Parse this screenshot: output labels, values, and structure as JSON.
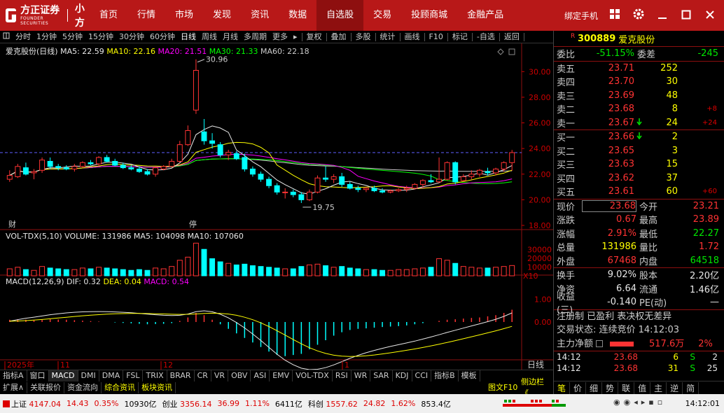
{
  "app": {
    "logo": "方正证券",
    "logo_sub": "FOUNDER SECURITIES",
    "brand": "小方",
    "menu": [
      {
        "label": "首页"
      },
      {
        "label": "行情"
      },
      {
        "label": "市场"
      },
      {
        "label": "发现"
      },
      {
        "label": "资讯"
      },
      {
        "label": "数据"
      },
      {
        "label": "自选股"
      },
      {
        "label": "交易"
      },
      {
        "label": "投顾商城"
      },
      {
        "label": "金融产品"
      }
    ],
    "menu_active_index": 6,
    "bind_phone": "绑定手机"
  },
  "toolbar": {
    "items": [
      "分时",
      "1分钟",
      "5分钟",
      "15分钟",
      "30分钟",
      "60分钟",
      "日线",
      "周线",
      "月线",
      "多周期",
      "更多"
    ],
    "active": "日线",
    "right_items": [
      "复权",
      "叠加",
      "多股",
      "统计",
      "画线",
      "F10",
      "标记",
      "-自选",
      "返回"
    ]
  },
  "chart": {
    "title": "爱克股份(日线)",
    "ma_legend": {
      "ma5": "MA5: 22.59",
      "ma10": "MA10: 22.16",
      "ma20": "MA20: 21.51",
      "ma30": "MA30: 21.33",
      "ma60": "MA60: 22.18"
    },
    "high_label": "30.96",
    "low_label": "19.75",
    "marker_cai": "财",
    "marker_ting": "停",
    "price_axis": [
      "30.00",
      "28.00",
      "26.00",
      "24.00",
      "22.00",
      "20.00",
      "18.00"
    ],
    "vol_legend": "VOL-TDX(5,10)  VOLUME: 131986  MA5: 104098  MA10: 107060",
    "vol_axis": [
      "30000",
      "20000",
      "10000"
    ],
    "vol_unit": "X10",
    "macd_legend_prefix": "MACD(12,26,9)",
    "macd_dif": "DIF: 0.32",
    "macd_dea": "DEA: 0.04",
    "macd_val": "MACD: 0.54",
    "macd_axis": [
      "1.00",
      "0.00"
    ],
    "date_axis": [
      "2025年",
      "11",
      "12",
      "1"
    ],
    "period_label": "日线"
  },
  "chart_data": {
    "type": "candlestick",
    "title": "爱克股份(日线)",
    "ylim": [
      18.0,
      31.0
    ],
    "candles": [
      {
        "o": 21.6,
        "h": 22.3,
        "l": 21.4,
        "c": 21.9
      },
      {
        "o": 21.8,
        "h": 22.8,
        "l": 21.7,
        "c": 22.6
      },
      {
        "o": 22.5,
        "h": 22.9,
        "l": 21.9,
        "c": 22.0
      },
      {
        "o": 22.1,
        "h": 22.4,
        "l": 21.6,
        "c": 22.2
      },
      {
        "o": 22.3,
        "h": 23.3,
        "l": 22.1,
        "c": 23.1
      },
      {
        "o": 23.0,
        "h": 23.3,
        "l": 22.4,
        "c": 22.6
      },
      {
        "o": 22.6,
        "h": 22.8,
        "l": 22.3,
        "c": 22.5
      },
      {
        "o": 22.5,
        "h": 22.7,
        "l": 22.3,
        "c": 22.4
      },
      {
        "o": 22.4,
        "h": 22.8,
        "l": 22.2,
        "c": 22.6
      },
      {
        "o": 22.6,
        "h": 23.0,
        "l": 22.5,
        "c": 22.9
      },
      {
        "o": 22.9,
        "h": 23.1,
        "l": 22.7,
        "c": 22.8
      },
      {
        "o": 22.8,
        "h": 23.4,
        "l": 22.6,
        "c": 23.3
      },
      {
        "o": 23.3,
        "h": 23.5,
        "l": 22.9,
        "c": 23.0
      },
      {
        "o": 23.0,
        "h": 23.2,
        "l": 22.6,
        "c": 22.7
      },
      {
        "o": 22.7,
        "h": 22.9,
        "l": 22.4,
        "c": 22.5
      },
      {
        "o": 22.5,
        "h": 22.7,
        "l": 22.3,
        "c": 22.4
      },
      {
        "o": 22.4,
        "h": 22.6,
        "l": 22.1,
        "c": 22.2
      },
      {
        "o": 22.2,
        "h": 22.4,
        "l": 21.9,
        "c": 22.0
      },
      {
        "o": 22.0,
        "h": 22.6,
        "l": 21.8,
        "c": 22.5
      },
      {
        "o": 22.4,
        "h": 22.7,
        "l": 22.3,
        "c": 22.6
      },
      {
        "o": 22.6,
        "h": 23.2,
        "l": 22.5,
        "c": 23.0
      },
      {
        "o": 23.0,
        "h": 24.6,
        "l": 22.9,
        "c": 24.3
      },
      {
        "o": 24.3,
        "h": 25.8,
        "l": 24.2,
        "c": 25.4
      },
      {
        "o": 27.0,
        "h": 30.96,
        "l": 26.7,
        "c": 30.1
      },
      {
        "o": 25.3,
        "h": 26.3,
        "l": 24.3,
        "c": 24.6
      },
      {
        "o": 24.6,
        "h": 25.2,
        "l": 24.0,
        "c": 24.4
      },
      {
        "o": 24.3,
        "h": 24.5,
        "l": 23.3,
        "c": 23.5
      },
      {
        "o": 23.5,
        "h": 23.9,
        "l": 23.1,
        "c": 23.7
      },
      {
        "o": 23.6,
        "h": 23.8,
        "l": 23.1,
        "c": 23.2
      },
      {
        "o": 23.3,
        "h": 23.6,
        "l": 22.2,
        "c": 22.4
      },
      {
        "o": 22.4,
        "h": 22.6,
        "l": 21.8,
        "c": 22.0
      },
      {
        "o": 22.0,
        "h": 22.2,
        "l": 21.4,
        "c": 21.6
      },
      {
        "o": 21.6,
        "h": 21.8,
        "l": 20.9,
        "c": 21.1
      },
      {
        "o": 21.1,
        "h": 21.3,
        "l": 20.4,
        "c": 20.6
      },
      {
        "o": 20.6,
        "h": 20.9,
        "l": 20.1,
        "c": 20.6
      },
      {
        "o": 20.6,
        "h": 20.8,
        "l": 20.2,
        "c": 20.4
      },
      {
        "o": 20.4,
        "h": 20.6,
        "l": 19.75,
        "c": 20.0
      },
      {
        "o": 20.0,
        "h": 20.8,
        "l": 19.9,
        "c": 20.6
      },
      {
        "o": 20.6,
        "h": 21.9,
        "l": 20.5,
        "c": 21.7
      },
      {
        "o": 21.7,
        "h": 22.6,
        "l": 21.4,
        "c": 21.6
      },
      {
        "o": 21.6,
        "h": 22.0,
        "l": 21.3,
        "c": 21.8
      },
      {
        "o": 21.8,
        "h": 22.1,
        "l": 21.0,
        "c": 21.2
      },
      {
        "o": 21.2,
        "h": 21.4,
        "l": 20.8,
        "c": 20.9
      },
      {
        "o": 20.9,
        "h": 21.1,
        "l": 20.6,
        "c": 20.8
      },
      {
        "o": 20.8,
        "h": 21.0,
        "l": 20.6,
        "c": 20.9
      },
      {
        "o": 20.9,
        "h": 21.1,
        "l": 20.6,
        "c": 20.7
      },
      {
        "o": 20.7,
        "h": 20.9,
        "l": 20.5,
        "c": 20.6
      },
      {
        "o": 20.6,
        "h": 20.8,
        "l": 20.5,
        "c": 20.7
      },
      {
        "o": 20.7,
        "h": 20.9,
        "l": 20.6,
        "c": 20.8
      },
      {
        "o": 20.8,
        "h": 21.1,
        "l": 20.6,
        "c": 20.9
      },
      {
        "o": 20.9,
        "h": 21.3,
        "l": 20.8,
        "c": 21.2
      },
      {
        "o": 21.2,
        "h": 21.6,
        "l": 21.0,
        "c": 21.5
      },
      {
        "o": 21.5,
        "h": 22.0,
        "l": 21.3,
        "c": 21.4
      },
      {
        "o": 21.4,
        "h": 23.3,
        "l": 21.3,
        "c": 21.6
      },
      {
        "o": 21.6,
        "h": 23.0,
        "l": 21.5,
        "c": 22.9
      },
      {
        "o": 22.9,
        "h": 23.0,
        "l": 21.2,
        "c": 21.4
      },
      {
        "o": 21.5,
        "h": 22.0,
        "l": 21.4,
        "c": 21.8
      },
      {
        "o": 21.8,
        "h": 22.3,
        "l": 21.6,
        "c": 22.0
      },
      {
        "o": 22.0,
        "h": 22.4,
        "l": 21.8,
        "c": 22.3
      },
      {
        "o": 22.2,
        "h": 22.5,
        "l": 21.9,
        "c": 22.1
      },
      {
        "o": 22.1,
        "h": 22.5,
        "l": 21.9,
        "c": 22.4
      },
      {
        "o": 22.4,
        "h": 23.0,
        "l": 22.2,
        "c": 22.9
      },
      {
        "o": 22.9,
        "h": 23.89,
        "l": 22.27,
        "c": 23.68
      }
    ],
    "ma5": {
      "name": "MA5",
      "last": 22.59
    },
    "ma10": {
      "name": "MA10",
      "last": 22.16
    },
    "ma20": {
      "name": "MA20",
      "last": 21.51
    },
    "ma30": {
      "name": "MA30",
      "last": 21.33
    },
    "ma60": {
      "name": "MA60",
      "last": 22.18
    },
    "volume": [
      9,
      11,
      8,
      7,
      12,
      10,
      9,
      8,
      8,
      10,
      9,
      11,
      10,
      9,
      8,
      7,
      8,
      7,
      10,
      9,
      12,
      20,
      24,
      42,
      34,
      22,
      18,
      16,
      14,
      15,
      13,
      12,
      11,
      10,
      9,
      9,
      12,
      14,
      15,
      13,
      11,
      12,
      10,
      9,
      8,
      8,
      7,
      7,
      8,
      8,
      9,
      10,
      11,
      22,
      20,
      16,
      12,
      11,
      10,
      10,
      11,
      12,
      13.2
    ],
    "volume_unit": "X10",
    "macd": [
      0.1,
      0.12,
      0.1,
      0.08,
      0.1,
      0.12,
      0.11,
      0.1,
      0.08,
      0.06,
      0.04,
      0.02,
      0.0,
      -0.02,
      -0.04,
      -0.06,
      -0.08,
      -0.1,
      -0.09,
      -0.08,
      -0.05,
      0.05,
      0.2,
      0.4,
      0.3,
      0.1,
      -0.1,
      -0.3,
      -0.5,
      -0.7,
      -0.9,
      -1.1,
      -1.3,
      -1.45,
      -1.5,
      -1.45,
      -1.4,
      -1.2,
      -1.0,
      -0.8,
      -0.6,
      -0.45,
      -0.35,
      -0.3,
      -0.28,
      -0.25,
      -0.22,
      -0.2,
      -0.18,
      -0.15,
      -0.1,
      -0.05,
      0.0,
      0.05,
      0.1,
      0.12,
      0.15,
      0.18,
      0.2,
      0.25,
      0.3,
      0.4,
      0.54
    ],
    "macd_ylim": [
      -1.6,
      1.6
    ],
    "dif_last": 0.32,
    "dea_last": 0.04,
    "macd_last": 0.54
  },
  "quote": {
    "code": "300889",
    "name": "爱克股份",
    "wei_bi_label": "委比",
    "wei_bi": "-51.15%",
    "wei_cha_label": "委差",
    "wei_cha": "-245",
    "sell": [
      {
        "label": "卖五",
        "price": "23.71",
        "vol": "252",
        "chg": ""
      },
      {
        "label": "卖四",
        "price": "23.70",
        "vol": "30",
        "chg": ""
      },
      {
        "label": "卖三",
        "price": "23.69",
        "vol": "48",
        "chg": ""
      },
      {
        "label": "卖二",
        "price": "23.68",
        "vol": "8",
        "chg": "+8"
      },
      {
        "label": "卖一",
        "price": "23.67",
        "vol": "24",
        "chg": "+24"
      }
    ],
    "buy": [
      {
        "label": "买一",
        "price": "23.66",
        "vol": "2",
        "chg": ""
      },
      {
        "label": "买二",
        "price": "23.65",
        "vol": "3",
        "chg": ""
      },
      {
        "label": "买三",
        "price": "23.63",
        "vol": "15",
        "chg": ""
      },
      {
        "label": "买四",
        "price": "23.62",
        "vol": "37",
        "chg": ""
      },
      {
        "label": "买五",
        "price": "23.61",
        "vol": "60",
        "chg": "+60"
      }
    ],
    "stats": [
      {
        "l1": "现价",
        "v1": "23.68",
        "l2": "今开",
        "v2": "23.21",
        "c1": "red",
        "c2": "red"
      },
      {
        "l1": "涨跌",
        "v1": "0.67",
        "l2": "最高",
        "v2": "23.89",
        "c1": "red",
        "c2": "red"
      },
      {
        "l1": "涨幅",
        "v1": "2.91%",
        "l2": "最低",
        "v2": "22.27",
        "c1": "red",
        "c2": "green"
      },
      {
        "l1": "总量",
        "v1": "131986",
        "l2": "量比",
        "v2": "1.72",
        "c1": "yellow",
        "c2": "red"
      },
      {
        "l1": "外盘",
        "v1": "67468",
        "l2": "内盘",
        "v2": "64518",
        "c1": "red",
        "c2": "green"
      }
    ],
    "stats2": [
      {
        "l1": "换手",
        "v1": "9.02%",
        "l2": "股本",
        "v2": "2.20亿"
      },
      {
        "l1": "净资",
        "v1": "6.64",
        "l2": "流通",
        "v2": "1.46亿"
      },
      {
        "l1": "收益(三)",
        "v1": "-0.140",
        "l2": "PE(动)",
        "v2": "—"
      }
    ],
    "register_info": "注册制 已盈利 表决权无差异",
    "trade_status": "交易状态: 连续竞价 14:12:03",
    "main_net_label": "主力净额",
    "main_net": "517.6万",
    "main_net_pct": "2%",
    "ticks": [
      {
        "time": "14:12",
        "price": "23.68",
        "vol": "6",
        "bs": "S",
        "n": "2"
      },
      {
        "time": "14:12",
        "price": "23.68",
        "vol": "31",
        "bs": "S",
        "n": "25"
      }
    ],
    "bottom_tabs": [
      "笔",
      "价",
      "细",
      "势",
      "联",
      "值",
      "主",
      "逆",
      "简"
    ]
  },
  "indicator_tabs": [
    "指标A",
    "窗口",
    "MACD",
    "DMI",
    "DMA",
    "FSL",
    "TRIX",
    "BRAR",
    "CR",
    "VR",
    "OBV",
    "ASI",
    "EMV",
    "VOL-TDX",
    "RSI",
    "WR",
    "SAR",
    "KDJ",
    "CCI",
    "指标B",
    "模板"
  ],
  "indicator_active": "MACD",
  "expand_tabs": [
    "扩展∧",
    "关联报价",
    "资金流向",
    "综合资讯",
    "板块资讯"
  ],
  "expand_right": "图文F10",
  "side_bar": "侧边栏《",
  "status": {
    "sh_label": "上证",
    "sh_val": "4147.04",
    "sh_chg": "14.43",
    "sh_pct": "0.35%",
    "sh_amt": "10930亿",
    "cy_label": "创业",
    "cy_val": "3356.14",
    "cy_chg": "36.99",
    "cy_pct": "1.11%",
    "cy_amt": "6411亿",
    "kc_label": "科创",
    "kc_val": "1557.62",
    "kc_chg": "24.82",
    "kc_pct": "1.62%",
    "kc_amt": "853.4亿",
    "time": "14:12:01"
  },
  "colors": {
    "up": "#ff3333",
    "down": "#00ffff",
    "title_bar": "#b81818",
    "ma5": "#e8e8e8",
    "ma10": "#ffff00",
    "ma20": "#ff00ff",
    "ma30": "#00ff00",
    "ma60": "#cccccc"
  }
}
